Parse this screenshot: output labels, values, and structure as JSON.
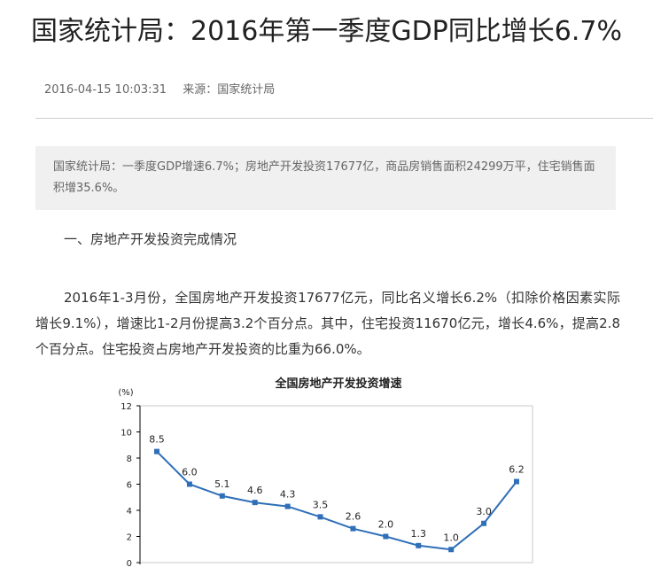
{
  "article": {
    "title": "国家统计局：2016年第一季度GDP同比增长6.7%",
    "date": "2016-04-15 10:03:31",
    "source": "来源：国家统计局",
    "summary": "国家统计局：一季度GDP增速6.7%；房地产开发投资17677亿，商品房销售面积24299万平，住宅销售面积增35.6%。",
    "section_heading": "一、房地产开发投资完成情况",
    "paragraph": "2016年1-3月份，全国房地产开发投资17677亿元，同比名义增长6.2%（扣除价格因素实际增长9.1%），增速比1-2月份提高3.2个百分点。其中，住宅投资11670亿元，增长4.6%，提高2.8个百分点。住宅投资占房地产开发投资的比重为66.0%。"
  },
  "colors": {
    "series_line": "#2f6fb8",
    "axis": "#000000",
    "plot_border": "#c8c8c8",
    "summary_bg": "#f0f0f0"
  },
  "chart_data": {
    "type": "line",
    "title": "全国房地产开发投资增速",
    "ylabel": "(%)",
    "ylim": [
      0,
      12
    ],
    "yticks": [
      0,
      2,
      4,
      6,
      8,
      10,
      12
    ],
    "grid": false,
    "series": [
      {
        "values": [
          8.5,
          6.0,
          5.1,
          4.6,
          4.3,
          3.5,
          2.6,
          2.0,
          1.3,
          1.0,
          3.0,
          6.2
        ]
      }
    ]
  }
}
